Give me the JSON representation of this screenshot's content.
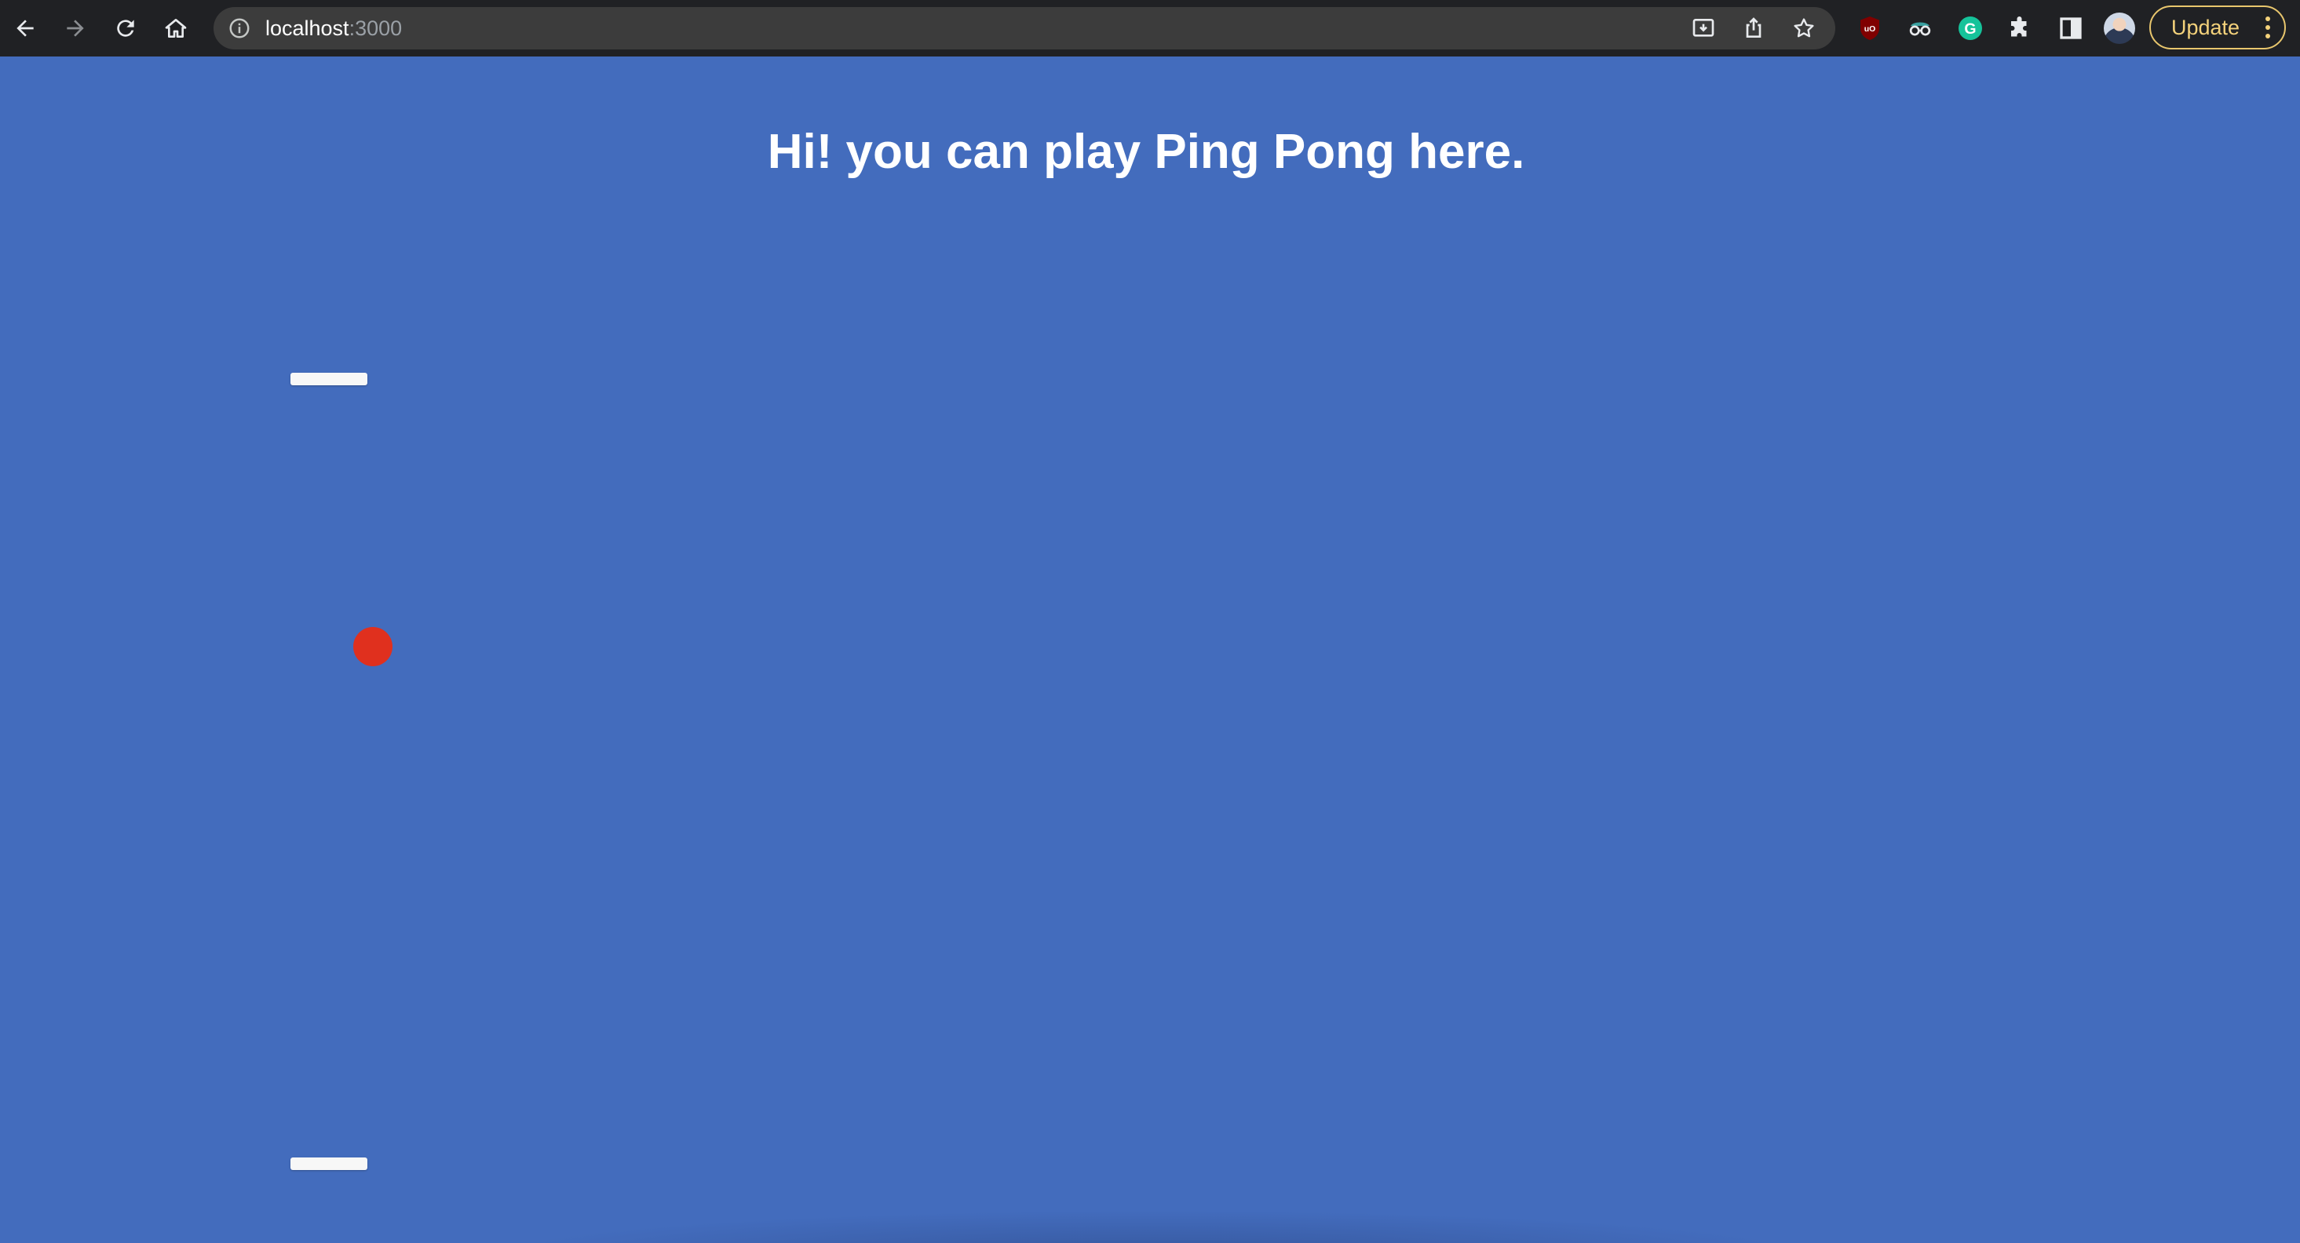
{
  "browser": {
    "url_host": "localhost",
    "url_port": ":3000",
    "update_label": "Update",
    "icons": {
      "back": "arrow-left-icon",
      "forward": "arrow-right-icon",
      "reload": "reload-icon",
      "home": "home-icon",
      "site_info": "info-icon",
      "install": "install-icon",
      "share": "share-icon",
      "bookmark": "star-icon",
      "ublock": "ublock-icon",
      "spy": "glasses-icon",
      "grammarly": "grammarly-icon",
      "extensions": "puzzle-icon",
      "side_panel": "side-panel-icon",
      "menu": "kebab-menu-icon"
    }
  },
  "page": {
    "title": "Hi! you can play Ping Pong here.",
    "colors": {
      "background": "#436cbd",
      "paddle": "#f7f7f7",
      "ball": "#e0301e"
    }
  }
}
